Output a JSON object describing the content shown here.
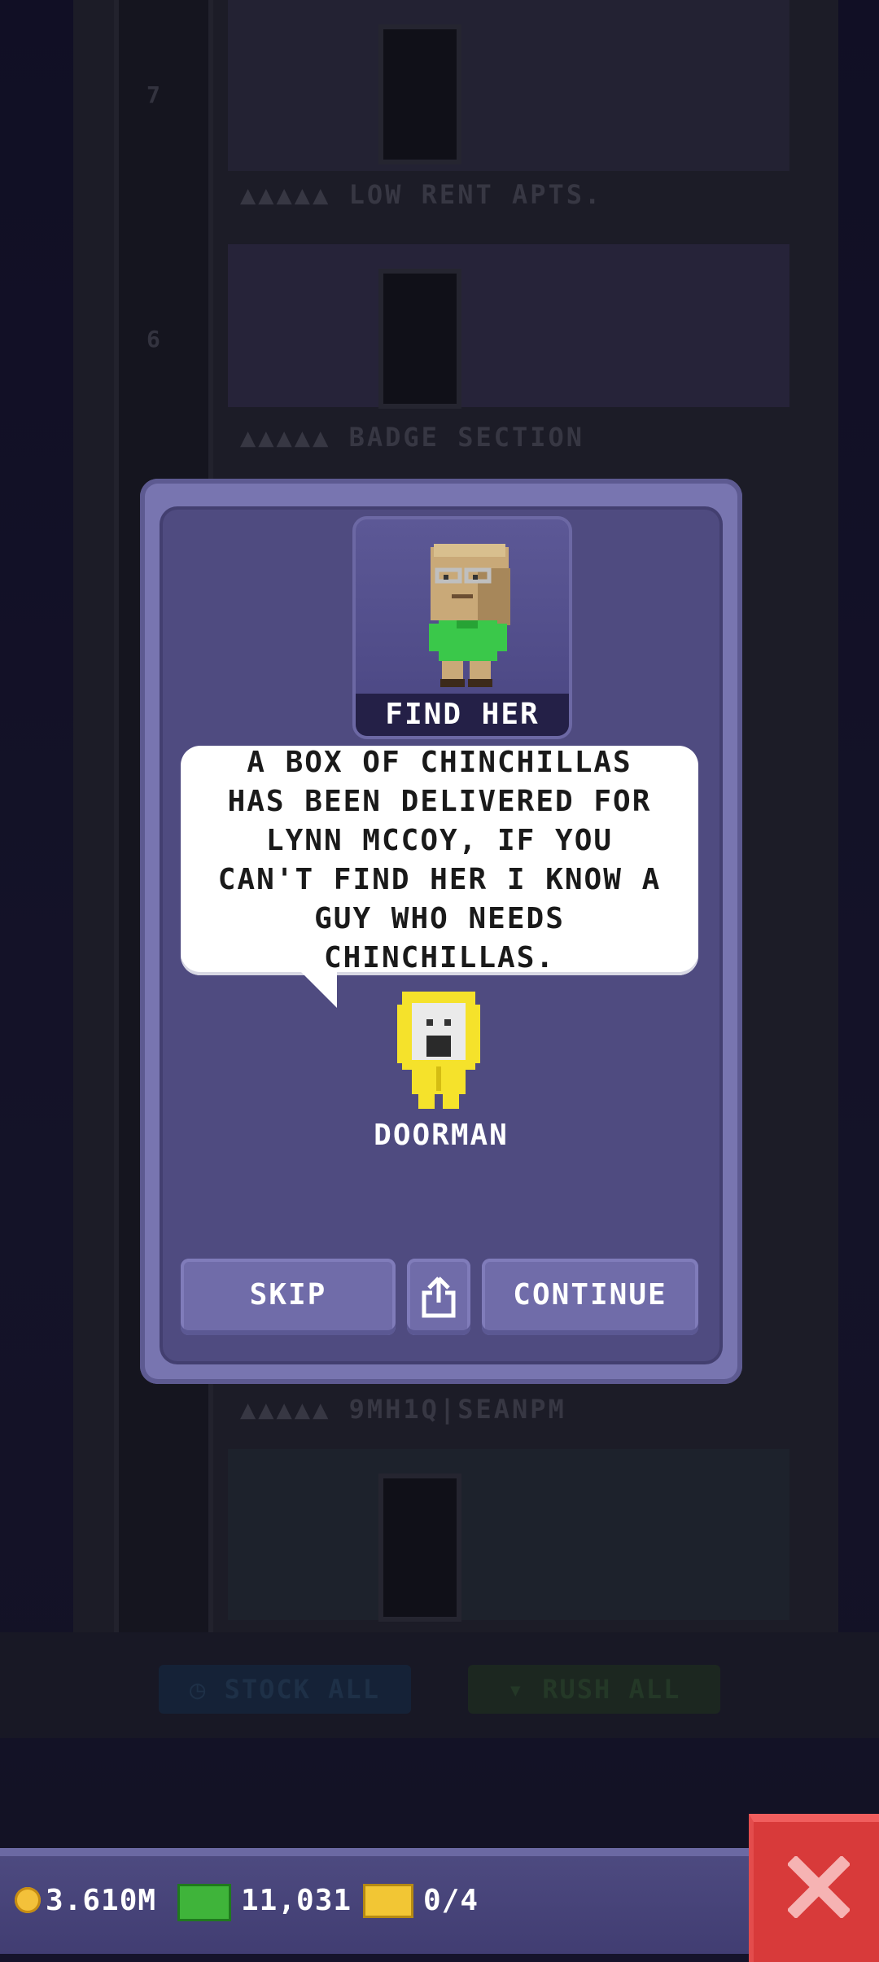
{
  "background": {
    "floor_labels": [
      "LOW RENT APTS.",
      "BADGE SECTION",
      "9MH1Q|SEANPM"
    ],
    "floor_numbers": [
      "7",
      "6"
    ],
    "stock_all_label": "STOCK ALL",
    "rush_all_label": "RUSH ALL"
  },
  "modal": {
    "portrait_banner": "FIND HER",
    "speech": "A BOX OF CHINCHILLAS HAS BEEN DELIVERED FOR LYNN MCCOY, IF YOU CAN'T FIND HER I KNOW A GUY WHO NEEDS CHINCHILLAS.",
    "speaker_name": "DOORMAN",
    "skip_label": "SKIP",
    "continue_label": "CONTINUE",
    "share_icon": "share-icon"
  },
  "status_bar": {
    "coins": "3.610M",
    "bux": "11,031",
    "tickets": "0/4",
    "coin_icon": "coin-icon",
    "bux_icon": "cash-icon",
    "ticket_icon": "ticket-icon",
    "close_icon": "close-icon"
  },
  "colors": {
    "modal_frame": "#7875b0",
    "modal_panel": "#4f4b80",
    "button": "#706ca9",
    "close_button": "#d83a3a",
    "doorman_yellow": "#f5e22b"
  }
}
